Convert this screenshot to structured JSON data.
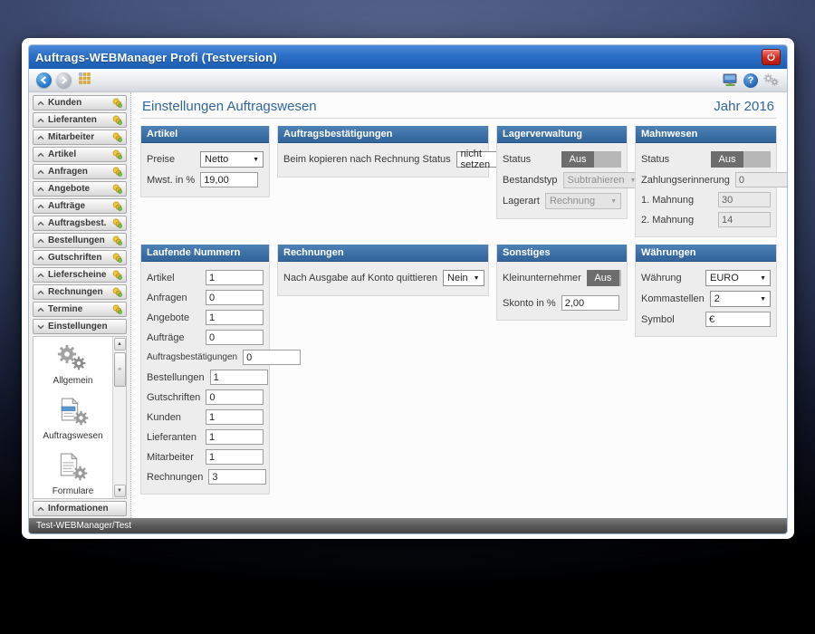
{
  "window": {
    "title": "Auftrags-WEBManager Profi (Testversion)",
    "status_text": "Test-WEBManager/Test"
  },
  "toolbar": {
    "help_glyph": "?"
  },
  "sidebar": {
    "items": [
      {
        "label": "Kunden"
      },
      {
        "label": "Lieferanten"
      },
      {
        "label": "Mitarbeiter"
      },
      {
        "label": "Artikel"
      },
      {
        "label": "Anfragen"
      },
      {
        "label": "Angebote"
      },
      {
        "label": "Aufträge"
      },
      {
        "label": "Auftragsbest."
      },
      {
        "label": "Bestellungen"
      },
      {
        "label": "Gutschriften"
      },
      {
        "label": "Lieferscheine"
      },
      {
        "label": "Rechnungen"
      },
      {
        "label": "Termine"
      }
    ],
    "einstellungen": {
      "label": "Einstellungen",
      "entries": [
        {
          "label": "Allgemein",
          "icon": "gears-icon"
        },
        {
          "label": "Auftragswesen",
          "icon": "document-gear-icon"
        },
        {
          "label": "Formulare",
          "icon": "forms-gear-icon"
        }
      ]
    },
    "informationen_label": "Informationen"
  },
  "main": {
    "page_title": "Einstellungen Auftragswesen",
    "year_label": "Jahr 2016",
    "panels": {
      "artikel": {
        "title": "Artikel",
        "preise_label": "Preise",
        "preise_value": "Netto",
        "mwst_label": "Mwst. in %",
        "mwst_value": "19,00"
      },
      "auftragsbestaetigungen": {
        "title": "Auftragsbestätigungen",
        "kopieren_label": "Beim kopieren nach Rechnung Status",
        "kopieren_value": "nicht setzen"
      },
      "lagerverwaltung": {
        "title": "Lagerverwaltung",
        "status_label": "Status",
        "status_value": "Aus",
        "bestandstyp_label": "Bestandstyp",
        "bestandstyp_value": "Subtrahieren",
        "lagerart_label": "Lagerart",
        "lagerart_value": "Rechnung"
      },
      "mahnwesen": {
        "title": "Mahnwesen",
        "status_label": "Status",
        "status_value": "Aus",
        "zahlungserinnerung_label": "Zahlungserinnerung",
        "zahlungserinnerung_value": "0",
        "mahnung1_label": "1. Mahnung",
        "mahnung1_value": "30",
        "mahnung2_label": "2. Mahnung",
        "mahnung2_value": "14"
      },
      "laufende_nummern": {
        "title": "Laufende Nummern",
        "rows": [
          {
            "label": "Artikel",
            "value": "1"
          },
          {
            "label": "Anfragen",
            "value": "0"
          },
          {
            "label": "Angebote",
            "value": "1"
          },
          {
            "label": "Aufträge",
            "value": "0"
          },
          {
            "label": "Auftragsbestätigungen",
            "value": "0"
          },
          {
            "label": "Bestellungen",
            "value": "1"
          },
          {
            "label": "Gutschriften",
            "value": "0"
          },
          {
            "label": "Kunden",
            "value": "1"
          },
          {
            "label": "Lieferanten",
            "value": "1"
          },
          {
            "label": "Mitarbeiter",
            "value": "1"
          },
          {
            "label": "Rechnungen",
            "value": "3"
          }
        ]
      },
      "rechnungen": {
        "title": "Rechnungen",
        "quittieren_label": "Nach Ausgabe auf Konto quittieren",
        "quittieren_value": "Nein"
      },
      "sonstiges": {
        "title": "Sonstiges",
        "kleinunternehmer_label": "Kleinunternehmer",
        "kleinunternehmer_value": "Aus",
        "skonto_label": "Skonto in %",
        "skonto_value": "2,00"
      },
      "waehrungen": {
        "title": "Währungen",
        "waehrung_label": "Währung",
        "waehrung_value": "EURO",
        "kommastellen_label": "Kommastellen",
        "kommastellen_value": "2",
        "symbol_label": "Symbol",
        "symbol_value": "€"
      }
    }
  },
  "colors": {
    "titlebar_blue": "#2a6ec6",
    "panel_header_blue": "#34689f",
    "accent_text_blue": "#31669f",
    "toggle_dark_gray": "#6d6d6d",
    "toggle_light_gray": "#b7b7b7",
    "status_red_power": "#d3281c"
  }
}
